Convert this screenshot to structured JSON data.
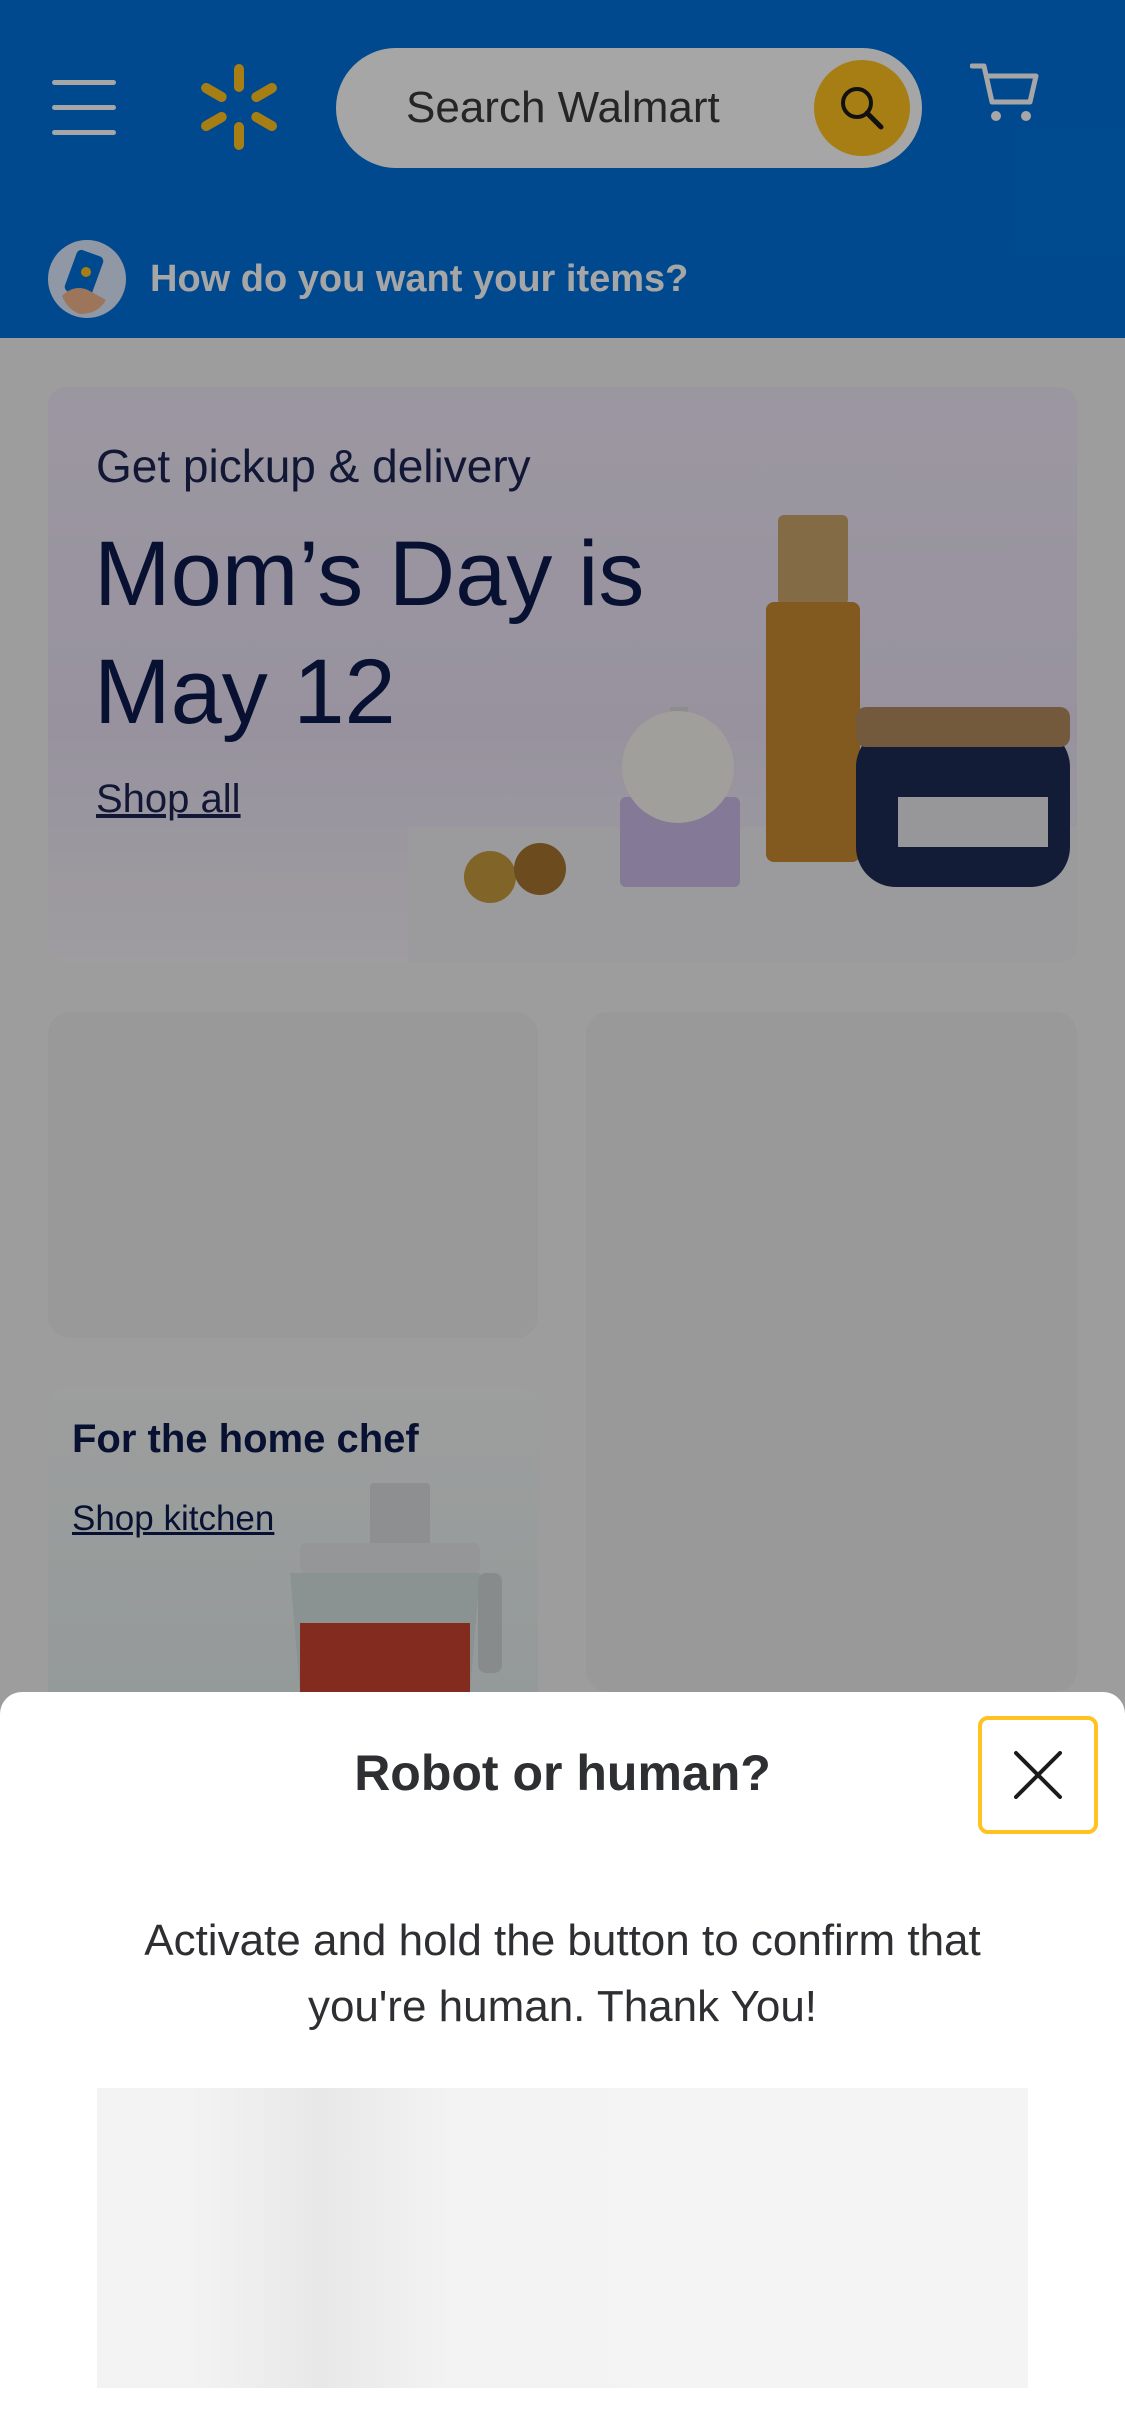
{
  "header": {
    "search_placeholder": "Search Walmart",
    "fulfillment_prompt": "How do you want your items?"
  },
  "hero": {
    "subtitle": "Get pickup & delivery",
    "title": "Mom’s Day is May 12",
    "link": "Shop all"
  },
  "cards": {
    "home_chef_title": "For the home chef",
    "home_chef_link": "Shop kitchen"
  },
  "modal": {
    "title": "Robot or human?",
    "body": "Activate and hold the button to confirm that you're human. Thank You!"
  },
  "colors": {
    "brand_blue": "#0071dc",
    "brand_yellow": "#ffc220",
    "navy_text": "#0d1b4d"
  },
  "icons": [
    "menu-icon",
    "spark-logo-icon",
    "search-icon",
    "cart-icon",
    "phone-hand-icon",
    "close-icon"
  ]
}
